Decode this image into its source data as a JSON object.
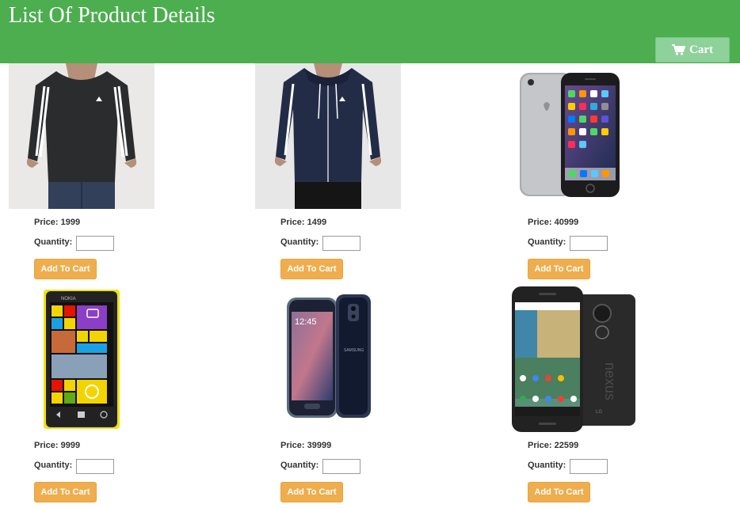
{
  "header": {
    "title": "List Of Product Details",
    "cart_label": "Cart",
    "cart_icon": "shopping-cart-icon",
    "background": "#4cae4f"
  },
  "product_card": {
    "price_prefix": "Price:",
    "quantity_label": "Quantity:",
    "add_to_cart_label": "Add To Cart",
    "button_color": "#efad4d"
  },
  "products": [
    {
      "name": "black-adidas-sweatshirt",
      "image": "black adidas sweatshirt photo",
      "price": "1999",
      "price_text": "Price: 1999",
      "quantity_label": "Quantity:",
      "quantity_value": "",
      "button": "Add To Cart"
    },
    {
      "name": "navy-adidas-hoodie",
      "image": "navy adidas zip hoodie photo",
      "price": "1499",
      "price_text": "Price: 1499",
      "quantity_label": "Quantity:",
      "quantity_value": "",
      "button": "Add To Cart"
    },
    {
      "name": "iphone-6",
      "image": "iphone photo",
      "price": "40999",
      "price_text": "Price: 40999",
      "quantity_label": "Quantity:",
      "quantity_value": "",
      "button": "Add To Cart"
    },
    {
      "name": "nokia-lumia",
      "image": "yellow nokia lumia photo",
      "price": "9999",
      "price_text": "Price: 9999",
      "quantity_label": "Quantity:",
      "quantity_value": "",
      "button": "Add To Cart"
    },
    {
      "name": "samsung-galaxy-s6",
      "image": "samsung galaxy s6 photo",
      "price": "39999",
      "price_text": "Price: 39999",
      "quantity_label": "Quantity:",
      "quantity_value": "",
      "button": "Add To Cart"
    },
    {
      "name": "nexus-5x",
      "image": "nexus phone photo",
      "price": "22599",
      "price_text": "Price: 22599",
      "quantity_label": "Quantity:",
      "quantity_value": "",
      "button": "Add To Cart"
    }
  ]
}
